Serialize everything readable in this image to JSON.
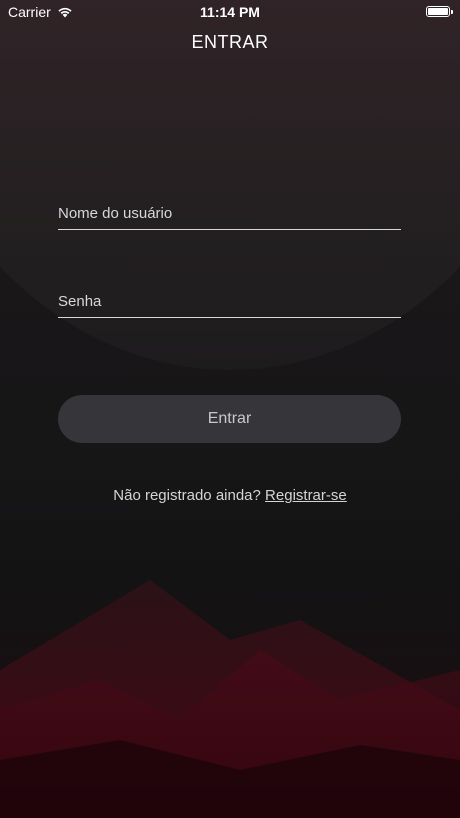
{
  "status_bar": {
    "carrier": "Carrier",
    "time": "11:14 PM"
  },
  "nav": {
    "title": "ENTRAR"
  },
  "form": {
    "username_placeholder": "Nome do usuário",
    "password_placeholder": "Senha",
    "submit_label": "Entrar"
  },
  "footer": {
    "prompt": "Não registrado ainda?",
    "register_link": "Registrar-se"
  }
}
